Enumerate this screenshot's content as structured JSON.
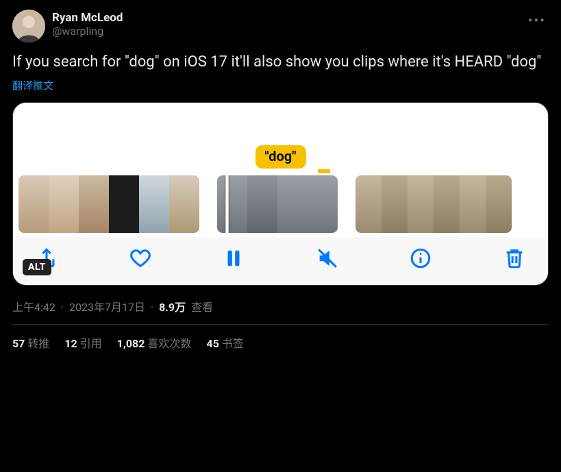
{
  "author": {
    "display_name": "Ryan McLeod",
    "handle": "@warpling"
  },
  "tweet_text": "If you search for \"dog\" on iOS 17 it'll also show you clips where it's HEARD \"dog\"",
  "translate_label": "翻译推文",
  "media": {
    "chip_text": "\"dog\"",
    "alt_badge": "ALT",
    "toolbar_icons": [
      "share",
      "heart",
      "pause",
      "mute",
      "info",
      "trash"
    ]
  },
  "meta": {
    "time": "上午4:42",
    "date": "2023年7月17日",
    "views_count": "8.9万",
    "views_label": "查看"
  },
  "stats": {
    "retweets": {
      "num": "57",
      "label": "转推"
    },
    "quotes": {
      "num": "12",
      "label": "引用"
    },
    "likes": {
      "num": "1,082",
      "label": "喜欢次数"
    },
    "bookmarks": {
      "num": "45",
      "label": "书签"
    }
  }
}
